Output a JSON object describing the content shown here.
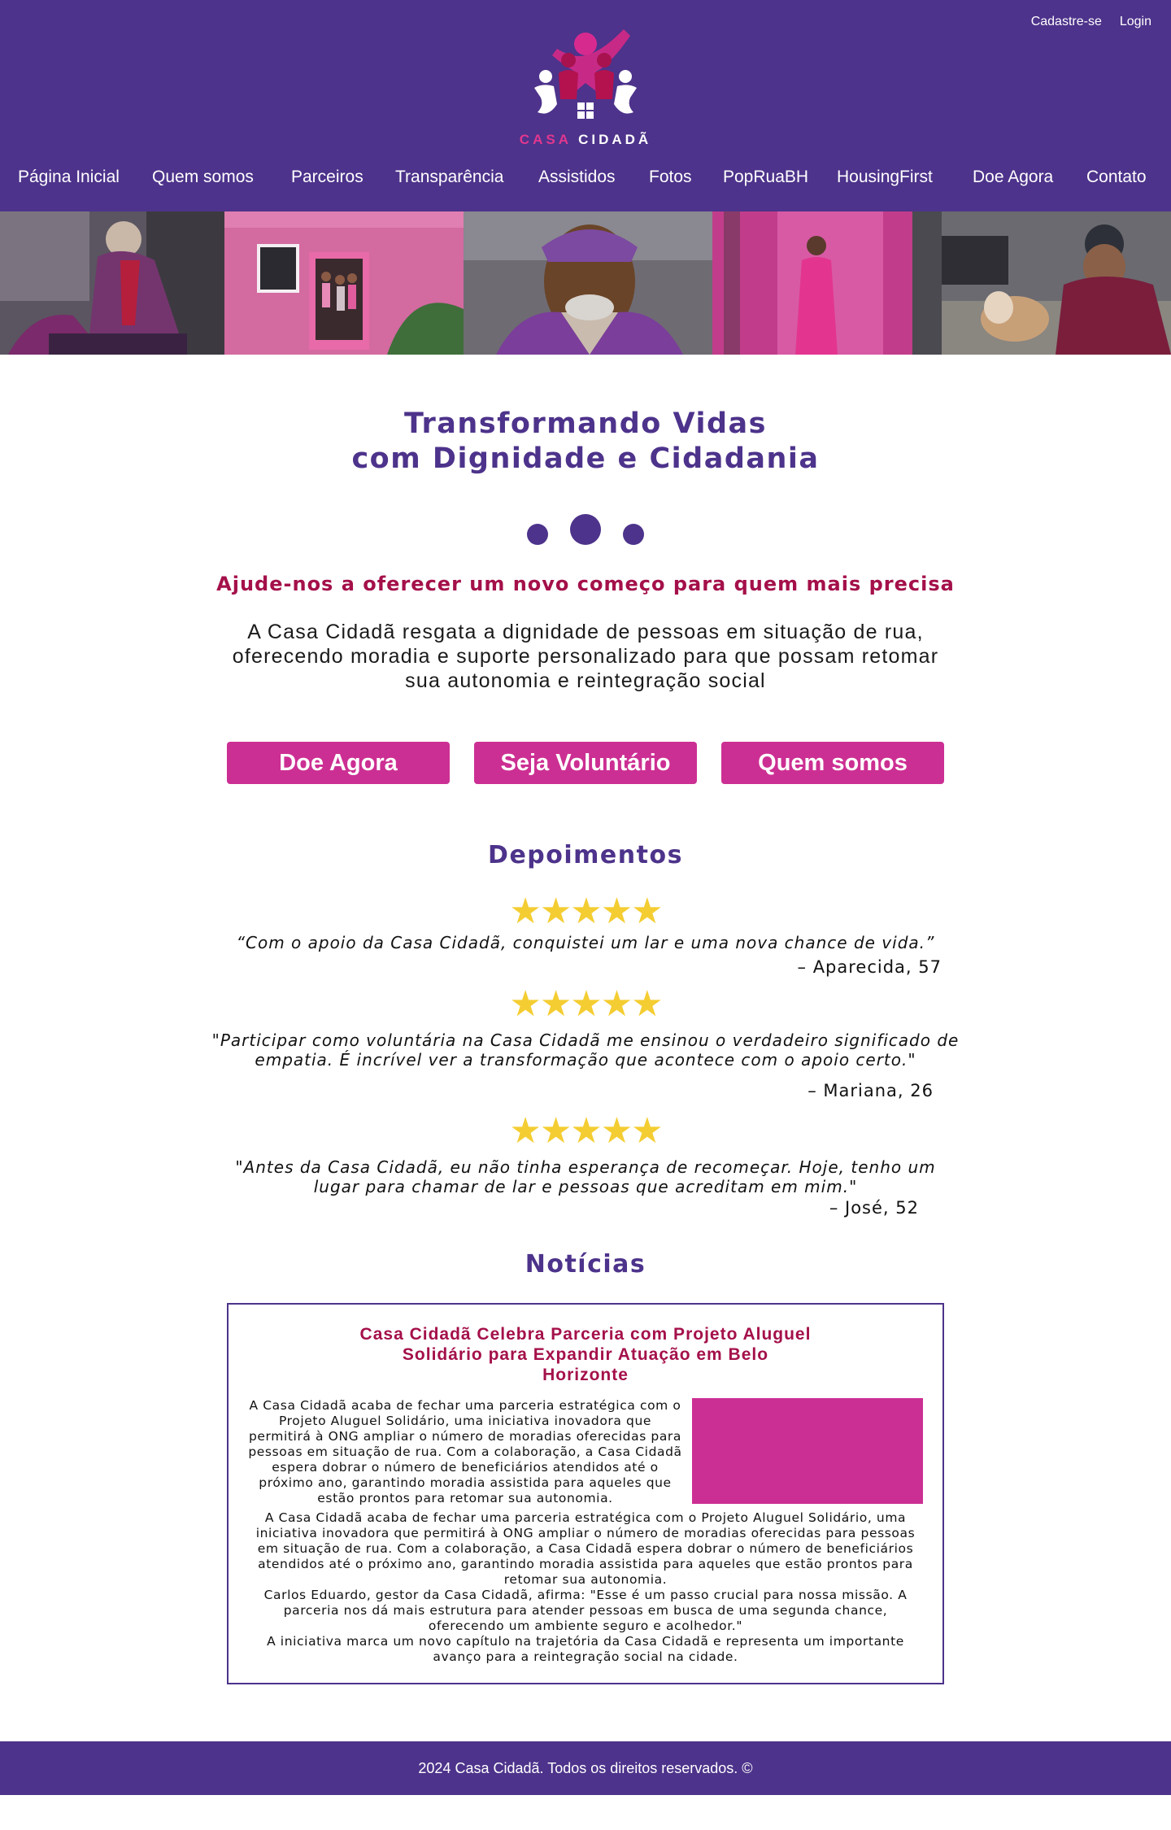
{
  "header": {
    "top_links": [
      "Cadastre-se",
      "Login"
    ],
    "logo": {
      "word1": "CASA",
      "word2": "CIDADÃ"
    },
    "nav": [
      "Página Inicial",
      "Quem somos",
      "Parceiros",
      "Transparência",
      "Assistidos",
      "Fotos",
      "PopRuaBH",
      "HousingFirst",
      "Doe Agora",
      "Contato"
    ]
  },
  "hero": {
    "title_line1": "Transformando Vidas",
    "title_line2": "com Dignidade e Cidadania",
    "subtitle": "Ajude-nos a oferecer um novo começo para quem mais precisa",
    "description": "A Casa Cidadã resgata a dignidade de pessoas em situação de rua, oferecendo moradia e suporte personalizado para que possam retomar sua autonomia e reintegração social",
    "buttons": [
      "Doe Agora",
      "Seja Voluntário",
      "Quem somos"
    ]
  },
  "testimonials": {
    "title": "Depoimentos",
    "stars": "★★★★★",
    "items": [
      {
        "quote": "“Com o apoio da Casa Cidadã, conquistei um lar e uma nova chance de vida.”",
        "author": "– Aparecida, 57"
      },
      {
        "quote": "\"Participar como voluntária na Casa Cidadã me ensinou o verdadeiro significado de empatia. É incrível ver a transformação que acontece com o apoio certo.\"",
        "author": "– Mariana, 26"
      },
      {
        "quote": "\"Antes da Casa Cidadã, eu não tinha esperança de recomeçar. Hoje, tenho um lugar para chamar de lar e pessoas que acreditam em mim.\"",
        "author": "– José, 52"
      }
    ]
  },
  "news": {
    "title": "Notícias",
    "headline": "Casa Cidadã Celebra Parceria com Projeto Aluguel Solidário para Expandir Atuação em Belo Horizonte",
    "paragraphs": [
      "A Casa Cidadã acaba de fechar uma parceria estratégica com o Projeto Aluguel Solidário, uma iniciativa inovadora que permitirá à ONG ampliar o número de moradias oferecidas para pessoas em situação de rua. Com a colaboração, a Casa Cidadã espera dobrar o número de beneficiários atendidos até o próximo ano, garantindo moradia assistida para aqueles que estão prontos para retomar sua autonomia.",
      "A Casa Cidadã acaba de fechar uma parceria estratégica com o Projeto Aluguel Solidário, uma iniciativa inovadora que permitirá à ONG ampliar o número de moradias oferecidas para pessoas em situação de rua. Com a colaboração, a Casa Cidadã espera dobrar o número de beneficiários atendidos até o próximo ano, garantindo moradia assistida para aqueles que estão prontos para retomar sua autonomia.",
      "Carlos Eduardo, gestor da Casa Cidadã, afirma: \"Esse é um passo crucial para nossa missão. A parceria nos dá mais estrutura para atender pessoas em busca de uma segunda chance, oferecendo um ambiente seguro e acolhedor.\"",
      "A iniciativa marca um novo capítulo na trajetória da Casa Cidadã e representa um importante avanço para a reintegração social na cidade."
    ]
  },
  "footer": {
    "text": "2024 Casa Cidadã. Todos os direitos reservados. ©"
  },
  "colors": {
    "primary": "#4d338b",
    "accent": "#cc2f93",
    "highlight": "#a4104a",
    "star": "#f4cd32"
  }
}
